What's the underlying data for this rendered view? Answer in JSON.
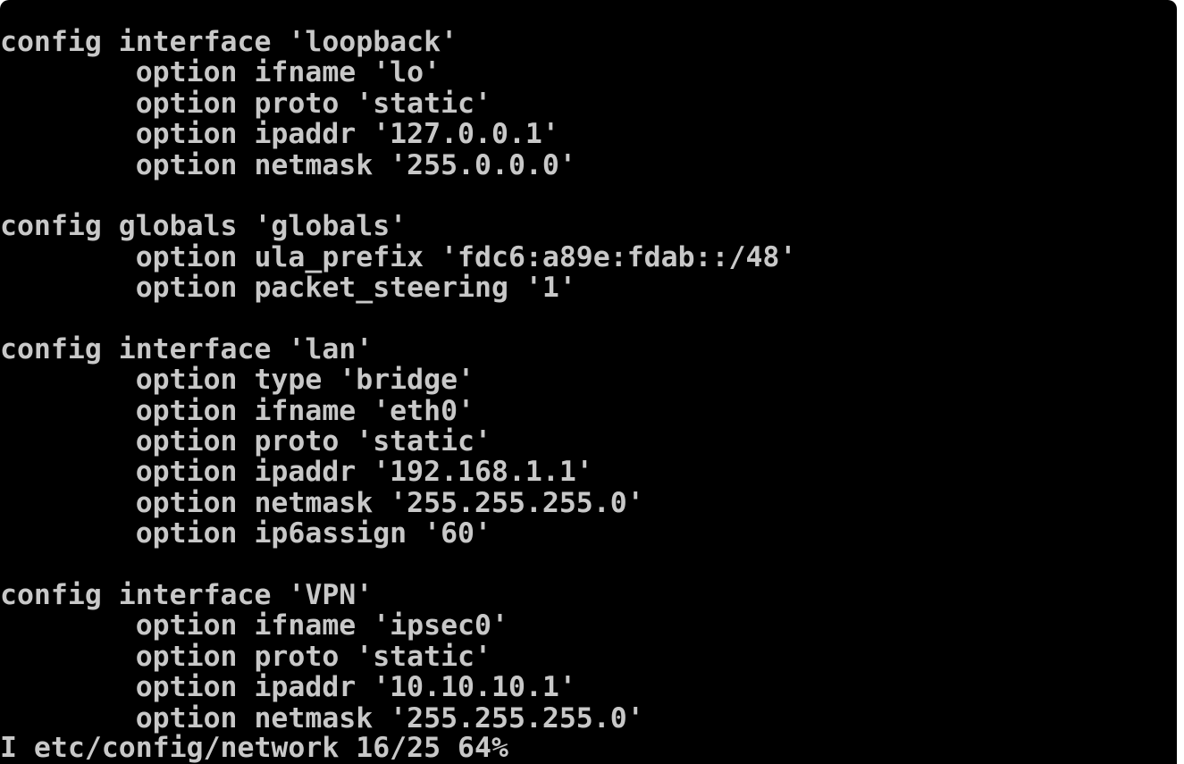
{
  "terminal": {
    "lines": [
      "config interface 'loopback'",
      "        option ifname 'lo'",
      "        option proto 'static'",
      "        option ipaddr '127.0.0.1'",
      "        option netmask '255.0.0.0'",
      "",
      "config globals 'globals'",
      "        option ula_prefix 'fdc6:a89e:fdab::/48'",
      "        option packet_steering '1'",
      "",
      "config interface 'lan'",
      "        option type 'bridge'",
      "        option ifname 'eth0'",
      "        option proto 'static'",
      "        option ipaddr '192.168.1.1'",
      "        option netmask '255.255.255.0'",
      "        option ip6assign '60'",
      "",
      "config interface 'VPN'",
      "        option ifname 'ipsec0'",
      "        option proto 'static'",
      "        option ipaddr '10.10.10.1'",
      "        option netmask '255.255.255.0'"
    ],
    "status_line": "I etc/config/network 16/25 64%"
  },
  "colors": {
    "background": "#000000",
    "text": "#c8c8c8",
    "page": "#ffffff"
  }
}
